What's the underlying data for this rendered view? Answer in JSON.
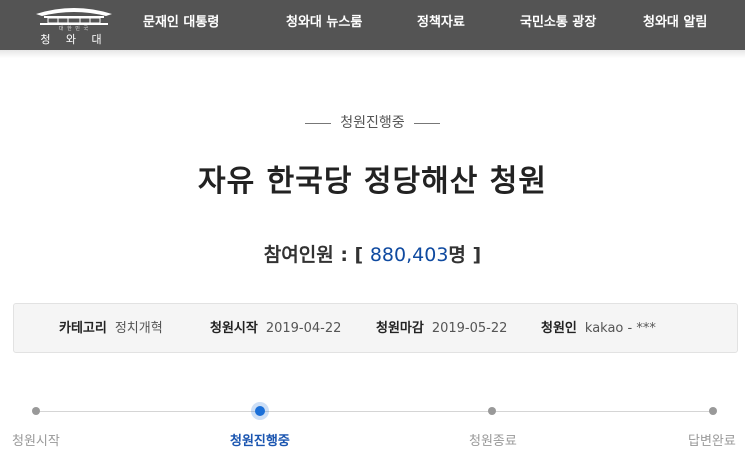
{
  "header": {
    "logo_small": "대 한 민 국",
    "logo_name": "청 와 대",
    "menu": [
      "문재인 대통령",
      "청와대 뉴스룸",
      "정책자료",
      "국민소통 광장",
      "청와대 알림"
    ]
  },
  "petition": {
    "status": "청원진행중",
    "title": "자유 한국당 정당해산 청원",
    "count_label": "참여인원 : [",
    "count_value": "880,403",
    "count_unit": "명 ]",
    "info": {
      "category_label": "카테고리",
      "category_value": "정치개혁",
      "start_label": "청원시작",
      "start_value": "2019-04-22",
      "end_label": "청원마감",
      "end_value": "2019-05-22",
      "author_label": "청원인",
      "author_value": "kakao - ***"
    },
    "steps": [
      "청원시작",
      "청원진행중",
      "청원종료",
      "답변완료"
    ],
    "active_step": 1
  },
  "colors": {
    "nav_bg": "#545454",
    "accent": "#1a6fd8",
    "count_blue": "#0f4aa0"
  }
}
